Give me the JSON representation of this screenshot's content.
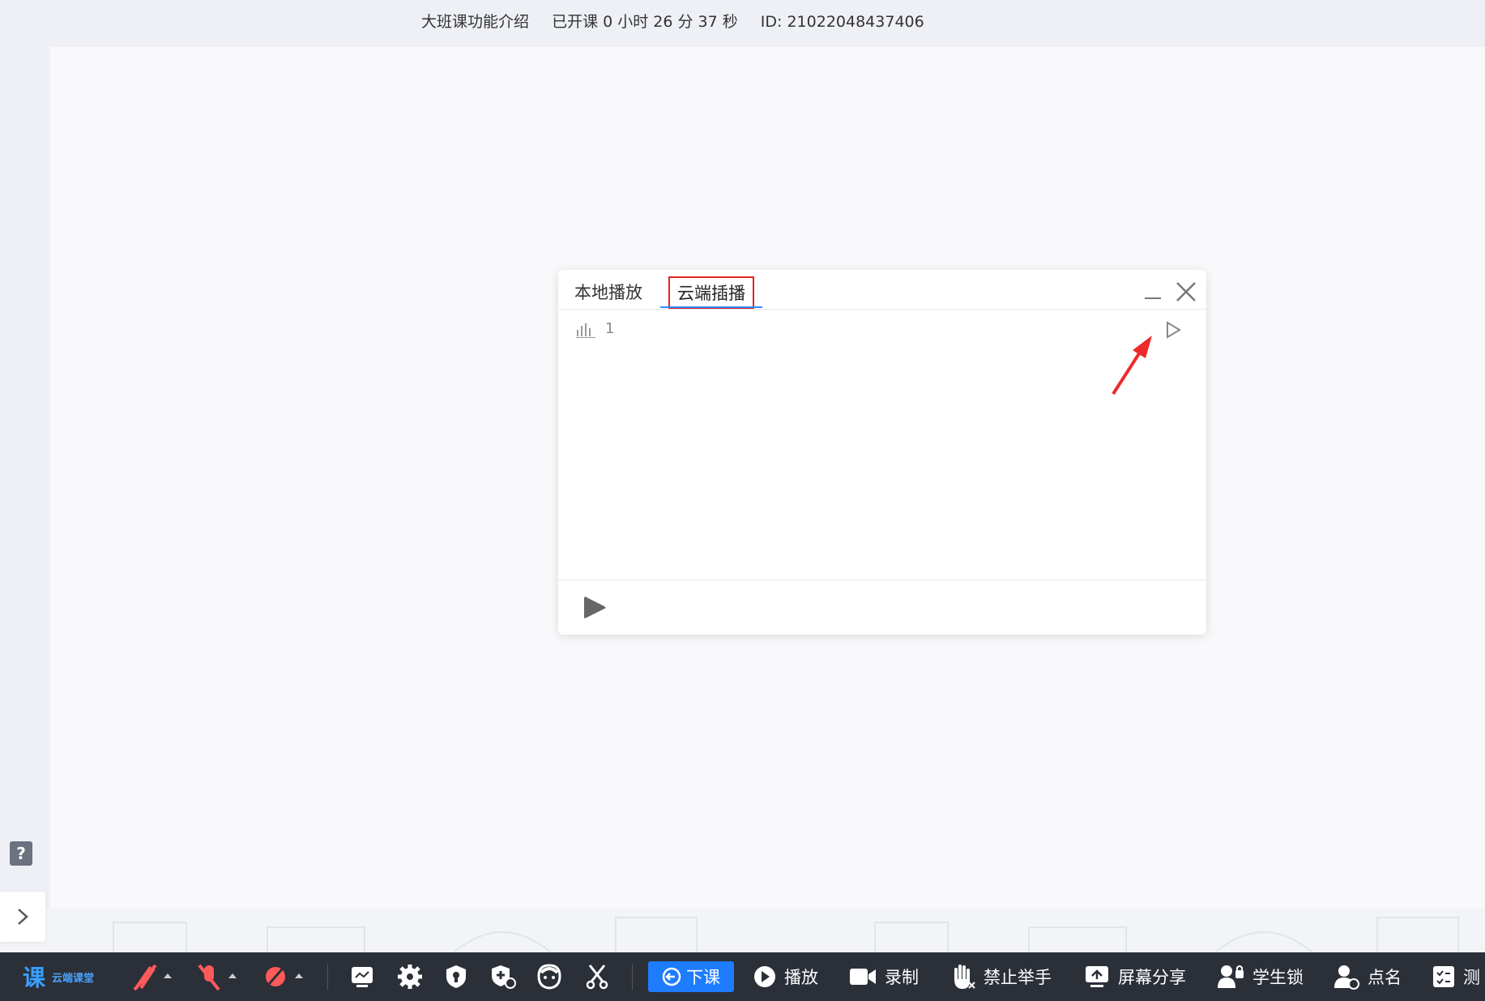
{
  "header": {
    "course_name": "大班课功能介绍",
    "elapsed": "已开课 0 小时 26 分 37 秒",
    "room_id": "ID: 21022048437406"
  },
  "dialog": {
    "tabs": [
      {
        "label": "本地播放"
      },
      {
        "label": "云端插播"
      }
    ],
    "track": {
      "label": "1"
    }
  },
  "toolbar": {
    "logo_text": "云端课堂",
    "dismiss_label": "下课",
    "play_label": "播放",
    "record_label": "录制",
    "no_raise_label": "禁止举手",
    "screen_share_label": "屏幕分享",
    "student_lock_label": "学生锁",
    "roll_call_label": "点名",
    "quiz_label": "测"
  },
  "colors": {
    "accent": "#1e7cff",
    "highlight": "#e02424",
    "toolbar_bg": "#2b2f38",
    "mute_icon": "#ff5a5a"
  }
}
